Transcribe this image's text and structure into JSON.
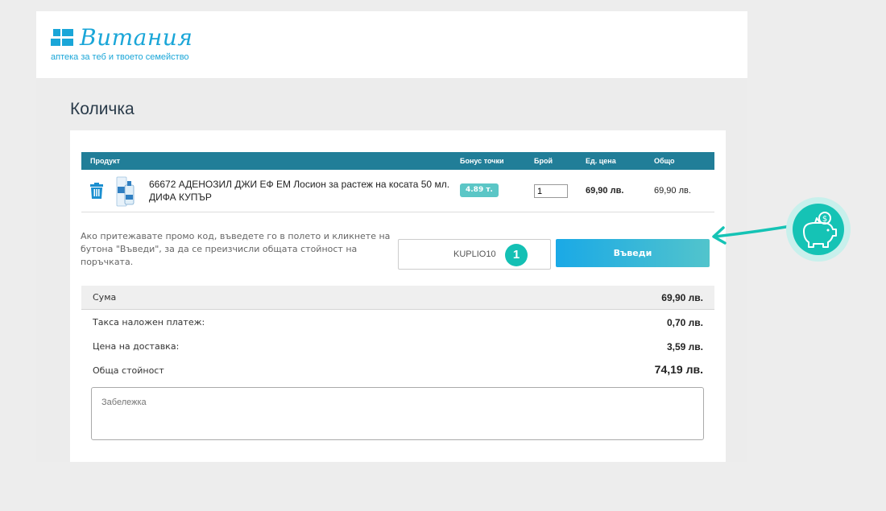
{
  "brand": {
    "name": "Витания",
    "tagline": "аптека за теб и твоето семейство",
    "color": "#1aa6d8"
  },
  "page": {
    "title": "Количка"
  },
  "table": {
    "headers": {
      "product": "Продукт",
      "bonus": "Бонус точки",
      "qty": "Брой",
      "unit_price": "Ед. цена",
      "total": "Общо"
    },
    "header_color": "#217e98",
    "rows": [
      {
        "name": "66672 АДЕНОЗИЛ ДЖИ ЕФ ЕМ Лосион за растеж на косата 50 мл. ДИФА КУПЪР",
        "bonus": "4.89 т.",
        "qty": "1",
        "unit_price": "69,90 лв.",
        "total": "69,90 лв."
      }
    ]
  },
  "promo": {
    "text": "Ако притежавате промо код, въведете го в полето и кликнете на бутона \"Въведи\", за да се преизчисли общата стойност на поръчката.",
    "code_value": "KUPLIO10",
    "step_number": "1",
    "button_label": "Въведи"
  },
  "summary": {
    "sum_label": "Сума",
    "sum_value": "69,90 лв.",
    "cod_label": "Такса наложен платеж:",
    "cod_value": "0,70 лв.",
    "delivery_label": "Цена на доставка:",
    "delivery_value": "3,59 лв.",
    "grand_label": "Обща стойност",
    "grand_value": "74,19 лв."
  },
  "note": {
    "placeholder": "Забележка"
  },
  "icons": {
    "trash": "trash-icon",
    "piggy": "piggy-bank-icon",
    "accent": "#15c3b5"
  }
}
